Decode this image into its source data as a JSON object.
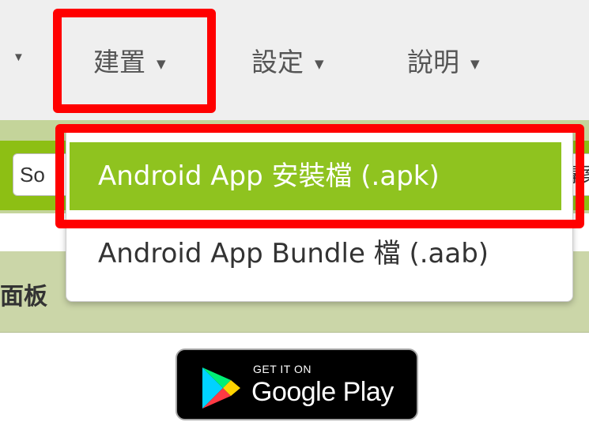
{
  "menubar": {
    "items": [
      {
        "label": "建置",
        "caret": "▼"
      },
      {
        "label": "設定",
        "caret": "▼"
      },
      {
        "label": "說明",
        "caret": "▼"
      }
    ],
    "prev_caret": "▼"
  },
  "toolbar": {
    "left_button_label": "So",
    "right_button_label": "專案"
  },
  "panel": {
    "label": "面板"
  },
  "dropdown": {
    "items": [
      {
        "label": "Android App 安裝檔 (.apk)",
        "active": true
      },
      {
        "label": "Android App Bundle 檔 (.aab)",
        "active": false
      }
    ]
  },
  "badge": {
    "small_text": "GET IT ON",
    "big_text": "Google Play"
  },
  "colors": {
    "highlight": "#ff0000",
    "active_item": "#8fc31f",
    "toolbar_green": "#8dbf14",
    "menubar_bg": "#efefef"
  },
  "icons": [
    "caret-down-icon",
    "google-play-logo"
  ]
}
